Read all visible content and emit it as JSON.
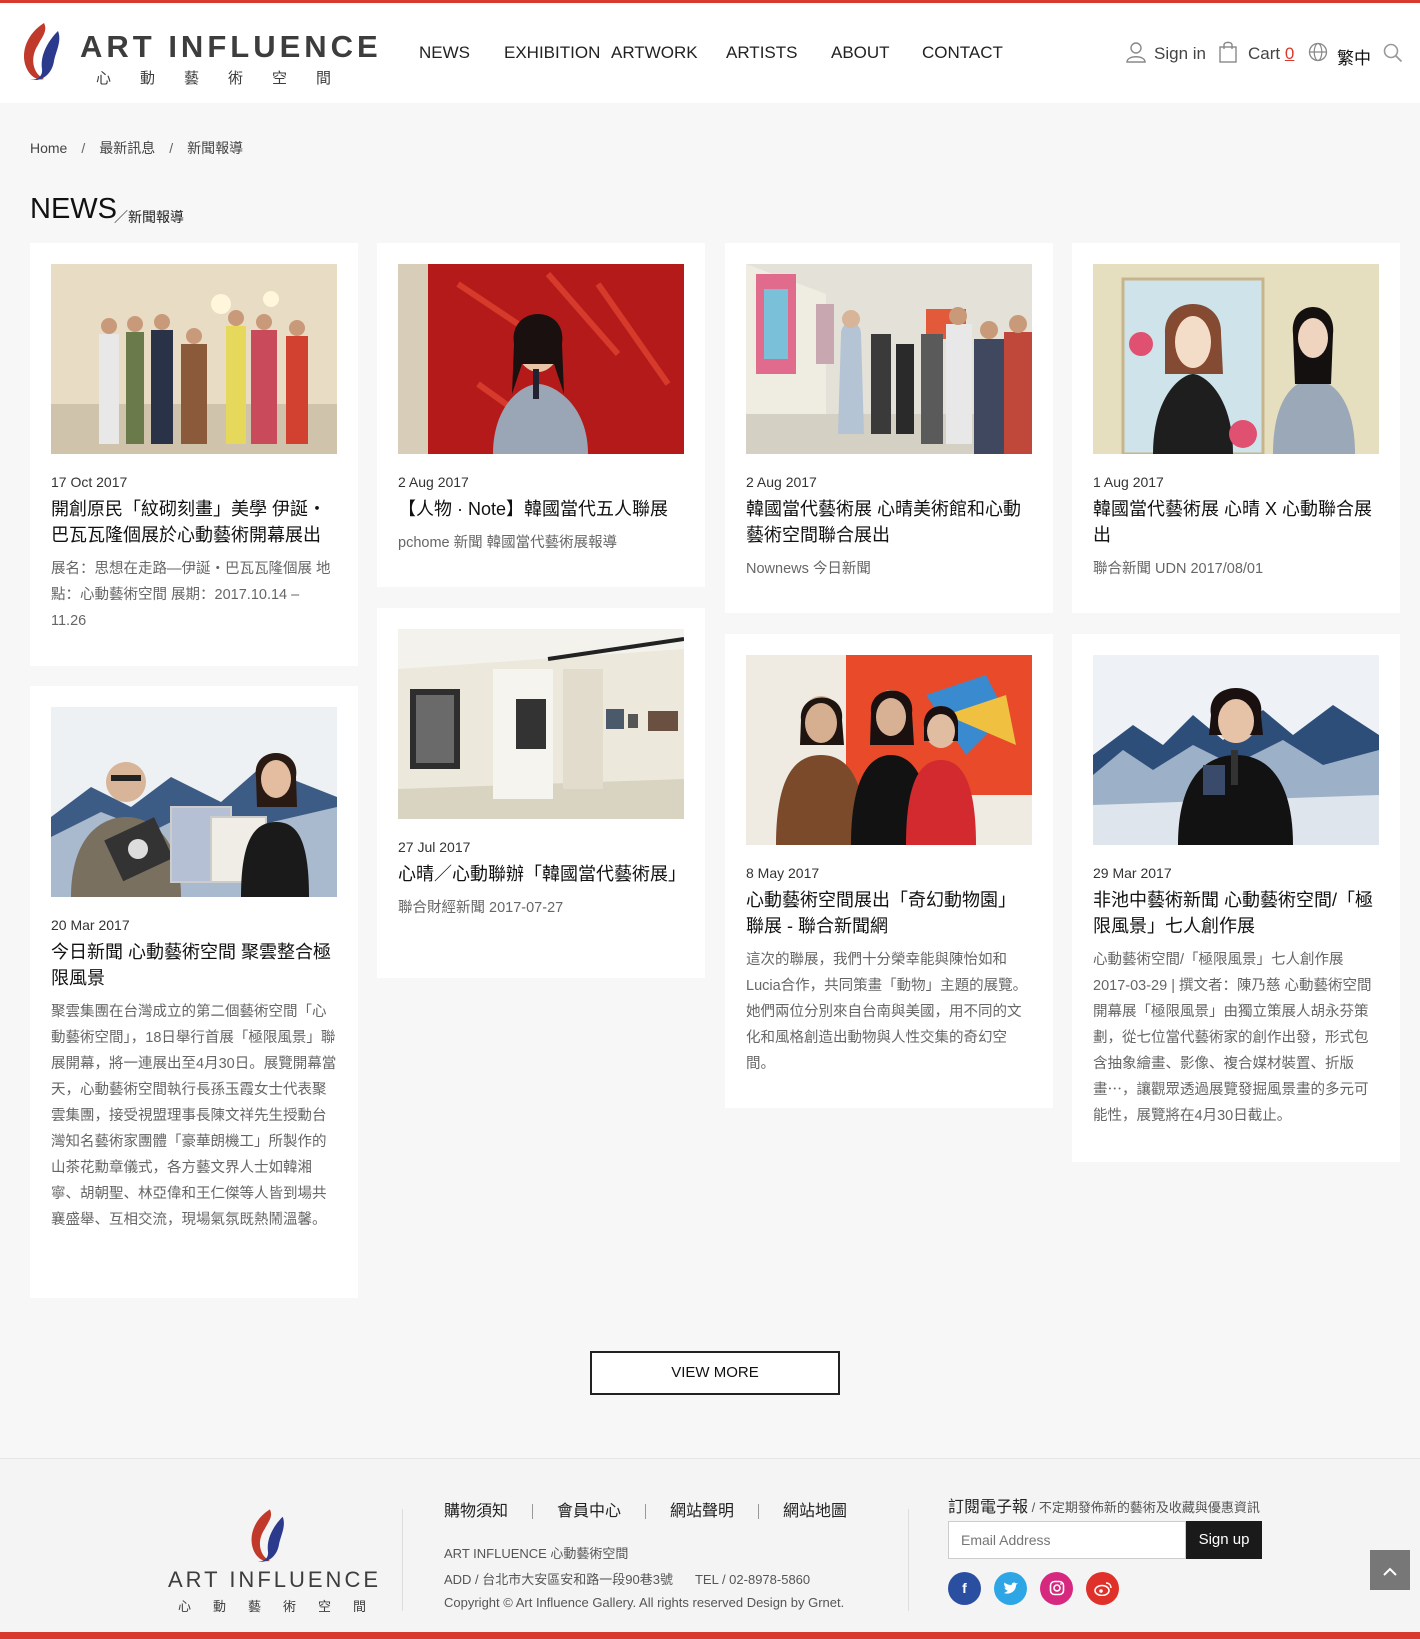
{
  "header": {
    "logo_title": "ART INFLUENCE",
    "logo_sub": "心動藝術空間",
    "nav": [
      "NEWS",
      "EXHIBITION",
      "ARTWORK",
      "ARTISTS",
      "ABOUT",
      "CONTACT"
    ],
    "signin": "Sign in",
    "cart_label": "Cart",
    "cart_count": "0",
    "language": "繁中"
  },
  "breadcrumb": [
    "Home",
    "最新訊息",
    "新聞報導"
  ],
  "breadcrumb_sep": "/",
  "page": {
    "title": "NEWS",
    "subtitle": "／新聞報導"
  },
  "cards": [
    {
      "date": "17 Oct 2017",
      "title": "開創原民「紋砌刻畫」美學 伊誕‧巴瓦瓦隆個展於心動藝術開幕展出",
      "body": "展名：思想在走路—伊誕・巴瓦瓦隆個展 地點：心動藝術空間 展期：2017.10.14 – 11.26"
    },
    {
      "date": "2 Aug 2017",
      "title": "【人物 · Note】韓國當代五人聯展",
      "body": "pchome 新聞 韓國當代藝術展報導"
    },
    {
      "date": "2 Aug 2017",
      "title": "韓國當代藝術展 心晴美術館和心動藝術空間聯合展出",
      "body": "Nownews 今日新聞"
    },
    {
      "date": "1 Aug 2017",
      "title": "韓國當代藝術展 心晴 X 心動聯合展出",
      "body": "聯合新聞 UDN 2017/08/01"
    },
    {
      "date": "20 Mar 2017",
      "title": "今日新聞 心動藝術空間 聚雲整合極限風景",
      "body": "聚雲集團在台灣成立的第二個藝術空間「心動藝術空間」，18日舉行首展「極限風景」聯展開幕，將一連展出至4月30日。展覽開幕當天，心動藝術空間執行長孫玉霞女士代表聚雲集團，接受視盟理事長陳文祥先生授勳台灣知名藝術家團體「豪華朗機工」所製作的山茶花勳章儀式，各方藝文界人士如韓湘寧、胡朝聖、林亞偉和王仁傑等人皆到場共襄盛舉、互相交流，現場氣氛既熱鬧溫馨。"
    },
    {
      "date": "27 Jul 2017",
      "title": "心晴／心動聯辦「韓國當代藝術展」",
      "body": "聯合財經新聞 2017-07-27"
    },
    {
      "date": "8 May 2017",
      "title": "心動藝術空間展出「奇幻動物園」聯展 - 聯合新聞網",
      "body": "這次的聯展，我們十分榮幸能與陳怡如和Lucia合作，共同策畫「動物」主題的展覽。她們兩位分別來自台南與美國，用不同的文化和風格創造出動物與人性交集的奇幻空間。"
    },
    {
      "date": "29 Mar 2017",
      "title": "非池中藝術新聞 心動藝術空間/「極限風景」七人創作展",
      "body": "心動藝術空間/「極限風景」七人創作展 2017-03-29 | 撰文者：陳乃慈 心動藝術空間開幕展「極限風景」由獨立策展人胡永芬策劃，從七位當代藝術家的創作出發，形式包含抽象繪畫、影像、複合媒材裝置、折版畫⋯，讓觀眾透過展覽發掘風景畫的多元可能性，展覽將在4月30日截止。"
    }
  ],
  "view_more": "VIEW MORE",
  "footer": {
    "logo_title": "ART INFLUENCE",
    "logo_sub": "心動藝術空間",
    "links": [
      "購物須知",
      "會員中心",
      "網站聲明",
      "網站地圖"
    ],
    "company": "ART INFLUENCE 心動藝術空間",
    "address": "ADD / 台北市大安區安和路一段90巷3號",
    "tel": "TEL / 02-8978-5860",
    "copyright": "Copyright © Art Influence Gallery. All rights reserved Design by Grnet.",
    "subscribe_title": "訂閱電子報",
    "subscribe_note": " / 不定期發佈新的藝術及收藏與優惠資訊",
    "email_placeholder": "Email Address",
    "signup": "Sign up"
  },
  "social_icons": [
    "facebook-icon",
    "twitter-icon",
    "instagram-icon",
    "weibo-icon"
  ],
  "colors": {
    "accent": "#d93a2e",
    "logo_red": "#c0392b",
    "logo_blue": "#2b3a8c"
  }
}
